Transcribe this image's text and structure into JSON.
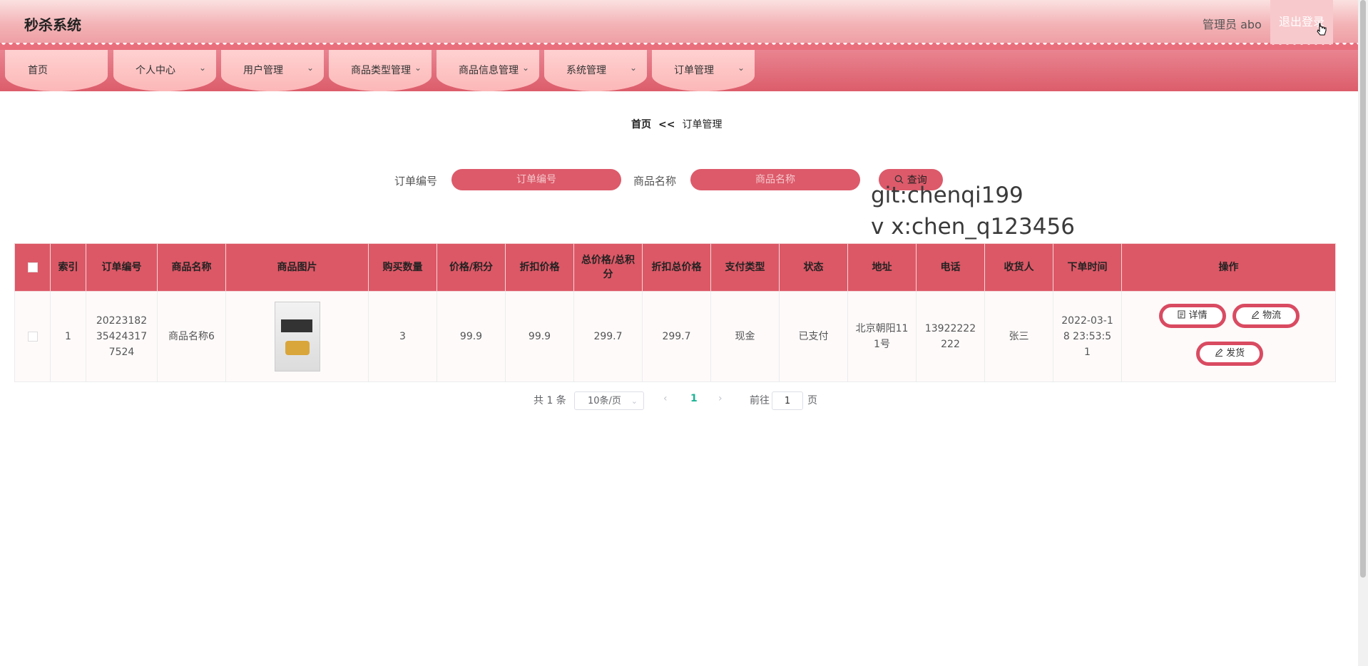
{
  "header": {
    "brand": "秒杀系统",
    "admin": "管理员 abo",
    "logout": "退出登录"
  },
  "nav": [
    {
      "label": "首页"
    },
    {
      "label": "个人中心"
    },
    {
      "label": "用户管理"
    },
    {
      "label": "商品类型管理"
    },
    {
      "label": "商品信息管理"
    },
    {
      "label": "系统管理"
    },
    {
      "label": "订单管理"
    }
  ],
  "breadcrumb": {
    "home": "首页",
    "sep": "<<",
    "current": "订单管理"
  },
  "search": {
    "order_label": "订单编号",
    "order_placeholder": "订单编号",
    "product_label": "商品名称",
    "product_placeholder": "商品名称",
    "query": "查询"
  },
  "watermark": {
    "line1": "git:chenqi199",
    "line2": "v x:chen_q123456"
  },
  "table": {
    "headers": [
      "索引",
      "订单编号",
      "商品名称",
      "商品图片",
      "购买数量",
      "价格/积分",
      "折扣价格",
      "总价格/总积分",
      "折扣总价格",
      "支付类型",
      "状态",
      "地址",
      "电话",
      "收货人",
      "下单时间",
      "操作"
    ],
    "rows": [
      {
        "index": "1",
        "order_no": "20223182354243177524",
        "product": "商品名称6",
        "qty": "3",
        "price": "99.9",
        "discount_price": "99.9",
        "total": "299.7",
        "discount_total": "299.7",
        "pay_type": "现金",
        "status": "已支付",
        "address": "北京朝阳111号",
        "phone": "13922222222",
        "receiver": "张三",
        "time": "2022-03-18 23:53:51"
      }
    ],
    "actions": {
      "detail": "详情",
      "logistics": "物流",
      "ship": "发货"
    }
  },
  "pagination": {
    "total": "共 1 条",
    "page_size": "10条/页",
    "current": "1",
    "goto": "前往",
    "goto_value": "1",
    "page_unit": "页"
  }
}
